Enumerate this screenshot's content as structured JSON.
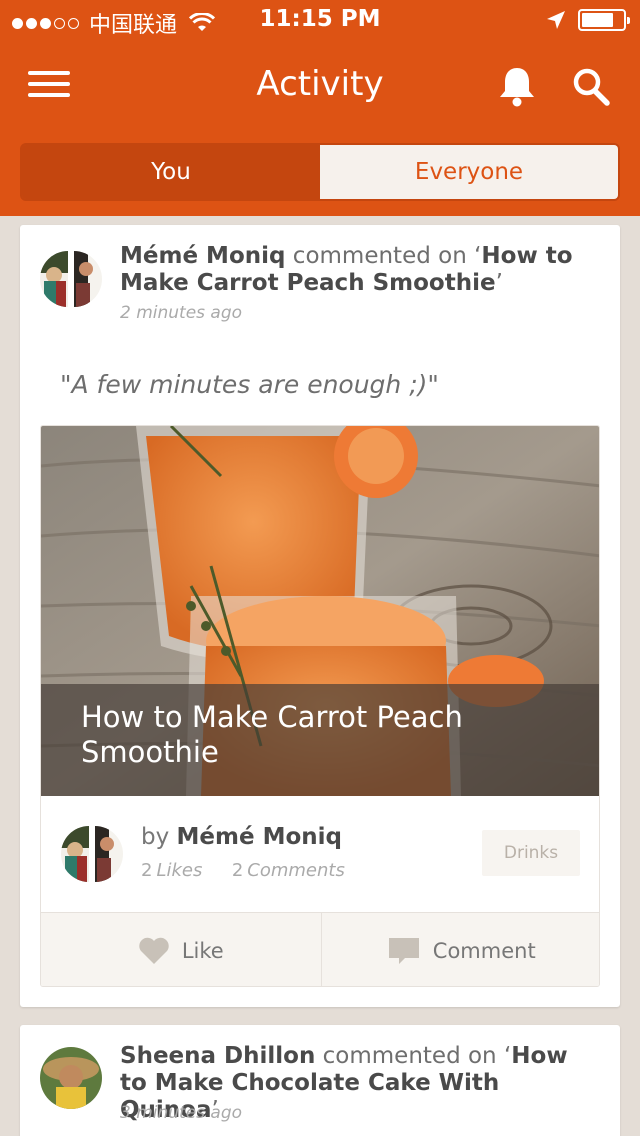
{
  "status_bar": {
    "carrier": "中国联通",
    "time": "11:15 PM",
    "signal_filled": 3,
    "signal_total": 5
  },
  "nav": {
    "title": "Activity",
    "tabs": [
      {
        "label": "You",
        "active": true
      },
      {
        "label": "Everyone",
        "active": false
      }
    ]
  },
  "feed": [
    {
      "user": "Mémé Moniq",
      "action": " commented on ‘",
      "target": "How to Make Carrot Peach Smoothie",
      "close": "’",
      "time": "2 minutes ago",
      "comment": "\"A few minutes are enough ;)\"",
      "recipe": {
        "title": "How to Make Carrot Peach Smoothie",
        "by_prefix": "by ",
        "author": "Mémé Moniq",
        "likes_count": "2",
        "likes_label": "Likes",
        "comments_count": "2",
        "comments_label": "Comments",
        "tag": "Drinks",
        "like_label": "Like",
        "comment_label": "Comment"
      }
    },
    {
      "user": "Sheena Dhillon",
      "action": " commented on ‘",
      "target": "How to Make Chocolate Cake With Quinoa",
      "close": "’",
      "time": "3 minutes ago"
    }
  ],
  "colors": {
    "brand": "#dd5314",
    "brand_dark": "#c4460f",
    "background": "#e4ddd6"
  },
  "icons": [
    "menu-icon",
    "bell-icon",
    "search-icon",
    "heart-icon",
    "comment-bubble-icon",
    "wifi-icon",
    "location-arrow-icon",
    "battery-icon"
  ]
}
